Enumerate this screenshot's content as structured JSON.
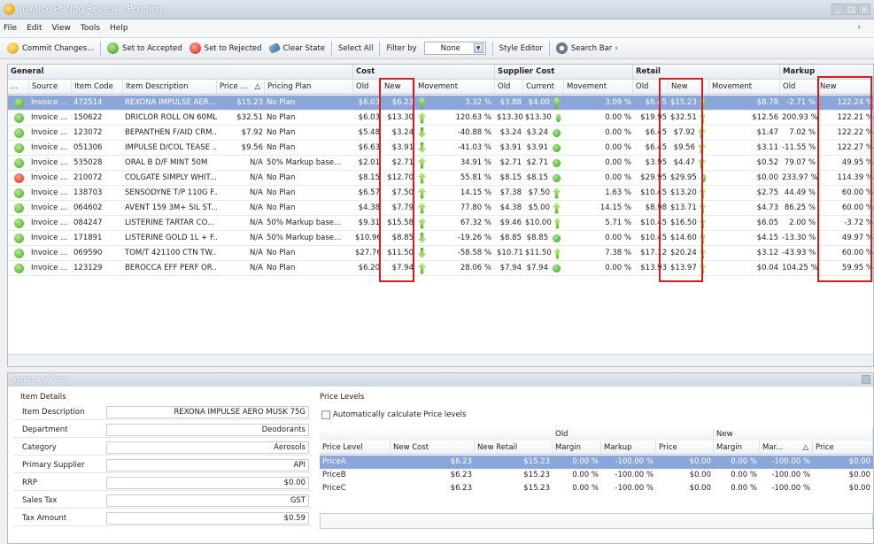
{
  "window": {
    "title": "Invoice Pricing Review - Pending"
  },
  "menu": [
    "File",
    "Edit",
    "View",
    "Tools",
    "Help"
  ],
  "toolbar": {
    "commit": "Commit Changes...",
    "accept": "Set to Accepted",
    "reject": "Set to Rejected",
    "clear": "Clear State",
    "select_all": "Select All",
    "filter_by": "Filter by",
    "filter_value": "None",
    "style_editor": "Style Editor",
    "search_bar": "Search Bar"
  },
  "grid": {
    "groups": {
      "general": "General",
      "cost": "Cost",
      "supplier": "Supplier Cost",
      "retail": "Retail",
      "markup": "Markup"
    },
    "headers": {
      "dots": "...",
      "source": "Source",
      "code": "Item Code",
      "desc": "Item Description",
      "price": "Price ...",
      "sort": "△",
      "plan": "Pricing Plan",
      "cost_old": "Old",
      "cost_new": "New",
      "cost_mv": "Movement",
      "sup_old": "Old",
      "sup_cur": "Current",
      "sup_mv": "Movement",
      "ret_old": "Old",
      "ret_new": "New",
      "ret_mv": "Movement",
      "mk_old": "Old",
      "mk_new": "New"
    },
    "rows": [
      {
        "status": "ok",
        "src": "Invoice ...",
        "code": "472514",
        "desc": "REXONA IMPULSE AER...",
        "price": "$15.23",
        "plan": "No Plan",
        "cold": "$6.03",
        "cnew": "$6.23",
        "cdir": "up",
        "cmv": "3.32 %",
        "sold": "$3.88",
        "scur": "$4.00",
        "sdir": "up",
        "smv": "3.09 %",
        "rold": "$6.45",
        "rnew": "$15.23",
        "rdir": "up",
        "rmv": "$8.78",
        "mold": "-2.71 %",
        "mnew": "122.24 %"
      },
      {
        "status": "ok",
        "src": "Invoice ...",
        "code": "150622",
        "desc": "DRICLOR ROLL ON 60ML",
        "price": "$32.51",
        "plan": "No Plan",
        "cold": "$6.03",
        "cnew": "$13.30",
        "cdir": "up",
        "cmv": "120.63 %",
        "sold": "$13.30",
        "scur": "$13.30",
        "sdir": "dot",
        "smv": "0.00 %",
        "rold": "$19.95",
        "rnew": "$32.51",
        "rdir": "up",
        "rmv": "$12.56",
        "mold": "200.93 %",
        "mnew": "122.21 %"
      },
      {
        "status": "ok",
        "src": "Invoice ...",
        "code": "123072",
        "desc": "BEPANTHEN F/AID CRM...",
        "price": "$7.92",
        "plan": "No Plan",
        "cold": "$5.48",
        "cnew": "$3.24",
        "cdir": "down",
        "cmv": "-40.88 %",
        "sold": "$3.24",
        "scur": "$3.24",
        "sdir": "dot",
        "smv": "0.00 %",
        "rold": "$6.45",
        "rnew": "$7.92",
        "rdir": "up",
        "rmv": "$1.47",
        "mold": "7.02 %",
        "mnew": "122.22 %"
      },
      {
        "status": "ok",
        "src": "Invoice ...",
        "code": "051306",
        "desc": "IMPULSE D/COL TEASE ...",
        "price": "$9.56",
        "plan": "No Plan",
        "cold": "$6.63",
        "cnew": "$3.91",
        "cdir": "down",
        "cmv": "-41.03 %",
        "sold": "$3.91",
        "scur": "$3.91",
        "sdir": "dot",
        "smv": "0.00 %",
        "rold": "$6.45",
        "rnew": "$9.56",
        "rdir": "up",
        "rmv": "$3.11",
        "mold": "-11.55 %",
        "mnew": "122.27 %"
      },
      {
        "status": "ok",
        "src": "Invoice ...",
        "code": "535028",
        "desc": "ORAL B D/F MINT 50M",
        "price": "N/A",
        "plan": "50% Markup base...",
        "cold": "$2.01",
        "cnew": "$2.71",
        "cdir": "up",
        "cmv": "34.91 %",
        "sold": "$2.71",
        "scur": "$2.71",
        "sdir": "dot",
        "smv": "0.00 %",
        "rold": "$3.95",
        "rnew": "$4.47",
        "rdir": "up",
        "rmv": "$0.52",
        "mold": "79.07 %",
        "mnew": "49.95 %"
      },
      {
        "status": "no",
        "src": "Invoice ...",
        "code": "210072",
        "desc": "COLGATE SIMPLY WHIT...",
        "price": "N/A",
        "plan": "No Plan",
        "cold": "$8.15",
        "cnew": "$12.70",
        "cdir": "up",
        "cmv": "55.81 %",
        "sold": "$8.15",
        "scur": "$8.15",
        "sdir": "dot",
        "smv": "0.00 %",
        "rold": "$29.95",
        "rnew": "$29.95",
        "rdir": "dot",
        "rmv": "$0.00",
        "mold": "233.97 %",
        "mnew": "114.39 %"
      },
      {
        "status": "ok",
        "src": "Invoice ...",
        "code": "138703",
        "desc": "SENSODYNE T/P 110G F...",
        "price": "N/A",
        "plan": "No Plan",
        "cold": "$6.57",
        "cnew": "$7.50",
        "cdir": "up",
        "cmv": "14.15 %",
        "sold": "$7.38",
        "scur": "$7.50",
        "sdir": "up",
        "smv": "1.63 %",
        "rold": "$10.45",
        "rnew": "$13.20",
        "rdir": "up",
        "rmv": "$2.75",
        "mold": "44.49 %",
        "mnew": "60.00 %"
      },
      {
        "status": "ok",
        "src": "Invoice ...",
        "code": "064602",
        "desc": "AVENT 159 3M+ SIL ST...",
        "price": "N/A",
        "plan": "No Plan",
        "cold": "$4.38",
        "cnew": "$7.79",
        "cdir": "up",
        "cmv": "77.80 %",
        "sold": "$4.38",
        "scur": "$5.00",
        "sdir": "up",
        "smv": "14.15 %",
        "rold": "$8.98",
        "rnew": "$13.71",
        "rdir": "up",
        "rmv": "$4.73",
        "mold": "86.25 %",
        "mnew": "60.00 %"
      },
      {
        "status": "ok",
        "src": "Invoice ...",
        "code": "084247",
        "desc": "LISTERINE TARTAR CO...",
        "price": "N/A",
        "plan": "50% Markup base...",
        "cold": "$9.31",
        "cnew": "$15.58",
        "cdir": "up",
        "cmv": "67.32 %",
        "sold": "$9.46",
        "scur": "$10.00",
        "sdir": "up",
        "smv": "5.71 %",
        "rold": "$10.45",
        "rnew": "$16.50",
        "rdir": "up",
        "rmv": "$6.05",
        "mold": "2.00 %",
        "mnew": "-3.72 %"
      },
      {
        "status": "ok",
        "src": "Invoice ...",
        "code": "171891",
        "desc": "LISTERINE GOLD 1L + F...",
        "price": "N/A",
        "plan": "50% Markup base...",
        "cold": "$10.96",
        "cnew": "$8.85",
        "cdir": "down",
        "cmv": "-19.26 %",
        "sold": "$8.85",
        "scur": "$8.85",
        "sdir": "dot",
        "smv": "0.00 %",
        "rold": "$10.45",
        "rnew": "$14.60",
        "rdir": "up",
        "rmv": "$4.15",
        "mold": "-13.30 %",
        "mnew": "49.97 %"
      },
      {
        "status": "ok",
        "src": "Invoice ...",
        "code": "069590",
        "desc": "TOM/T 421100 CTN TW...",
        "price": "N/A",
        "plan": "No Plan",
        "cold": "$27.76",
        "cnew": "$11.50",
        "cdir": "down",
        "cmv": "-58.58 %",
        "sold": "$10.71",
        "scur": "$11.50",
        "sdir": "up",
        "smv": "7.38 %",
        "rold": "$17.12",
        "rnew": "$20.24",
        "rdir": "up",
        "rmv": "$3.12",
        "mold": "-43.93 %",
        "mnew": "60.00 %"
      },
      {
        "status": "ok",
        "src": "Invoice ...",
        "code": "123129",
        "desc": "BEROCCA EFF PERF OR...",
        "price": "N/A",
        "plan": "No Plan",
        "cold": "$6.20",
        "cnew": "$7.94",
        "cdir": "up",
        "cmv": "28.06 %",
        "sold": "$7.94",
        "scur": "$7.94",
        "sdir": "dot",
        "smv": "0.00 %",
        "rold": "$13.93",
        "rnew": "$13.97",
        "rdir": "up",
        "rmv": "$0.04",
        "mold": "104.25 %",
        "mnew": "59.95 %"
      }
    ]
  },
  "summary": {
    "title": "Summary Pane",
    "item_details_title": "Item Details",
    "fields": [
      {
        "k": "Item Description",
        "v": "REXONA IMPULSE AERO MUSK 75G"
      },
      {
        "k": "Department",
        "v": "Deodorants"
      },
      {
        "k": "Category",
        "v": "Aerosols"
      },
      {
        "k": "Primary Supplier",
        "v": "API"
      },
      {
        "k": "RRP",
        "v": "$0.00"
      },
      {
        "k": "Sales Tax",
        "v": "GST"
      },
      {
        "k": "Tax Amount",
        "v": "$0.59"
      }
    ],
    "price_levels_title": "Price Levels",
    "auto_calc": "Automatically calculate Price levels",
    "ph": {
      "old": "Old",
      "new": "New",
      "level": "Price Level",
      "new_cost": "New Cost",
      "new_retail": "New Retail",
      "margin": "Margin",
      "markup": "Markup",
      "price": "Price",
      "margin2": "Margin",
      "markup2": "Mar...",
      "sort": "△",
      "price2": "Price"
    },
    "levels": [
      {
        "name": "PriceA",
        "cost": "$6.23",
        "retail": "$15.23",
        "margin": "0.00 %",
        "markup": "-100.00 %",
        "price": "$0.00",
        "margin2": "0.00 %",
        "markup2": "-100.00 %",
        "price2": "$0.00"
      },
      {
        "name": "PriceB",
        "cost": "$6.23",
        "retail": "$15.23",
        "margin": "0.00 %",
        "markup": "-100.00 %",
        "price": "$0.00",
        "margin2": "0.00 %",
        "markup2": "-100.00 %",
        "price2": "$0.00"
      },
      {
        "name": "PriceC",
        "cost": "$6.23",
        "retail": "$15.23",
        "margin": "0.00 %",
        "markup": "-100.00 %",
        "price": "$0.00",
        "margin2": "0.00 %",
        "markup2": "-100.00 %",
        "price2": "$0.00"
      }
    ]
  },
  "colors": {
    "selection": "#8ba6d9",
    "highlight_box": "#d31f1f",
    "up_arrow": "#55b51e",
    "accepted": "#46a322",
    "rejected": "#d22a1a"
  },
  "icons": [
    "app-coin-icon",
    "commit-icon",
    "accept-icon",
    "reject-icon",
    "eraser-icon",
    "dropdown-arrow-icon",
    "search-bar-icon",
    "status-ok-icon",
    "status-reject-icon",
    "arrow-up-icon",
    "arrow-down-icon",
    "no-change-dot-icon"
  ]
}
